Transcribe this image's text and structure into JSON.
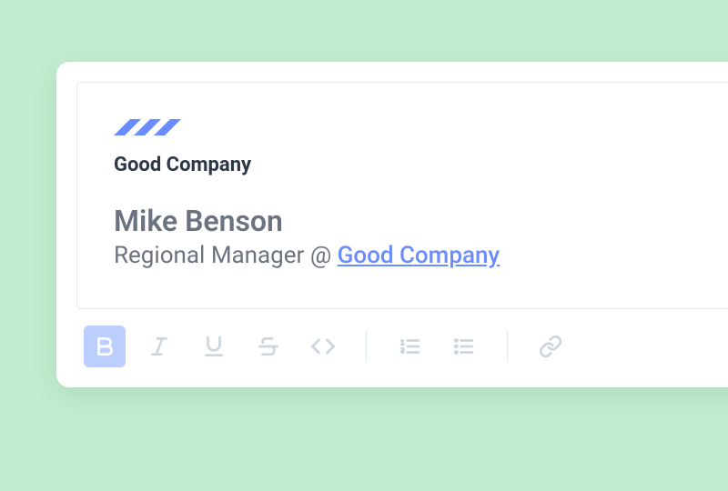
{
  "logo": {
    "text": "Good Company"
  },
  "signature": {
    "name": "Mike Benson",
    "title_prefix": "Regional Manager @ ",
    "company_link": "Good Company"
  },
  "toolbar": {
    "bold_active": true
  },
  "colors": {
    "accent": "#6b8cff",
    "bg": "#c1ecce"
  }
}
